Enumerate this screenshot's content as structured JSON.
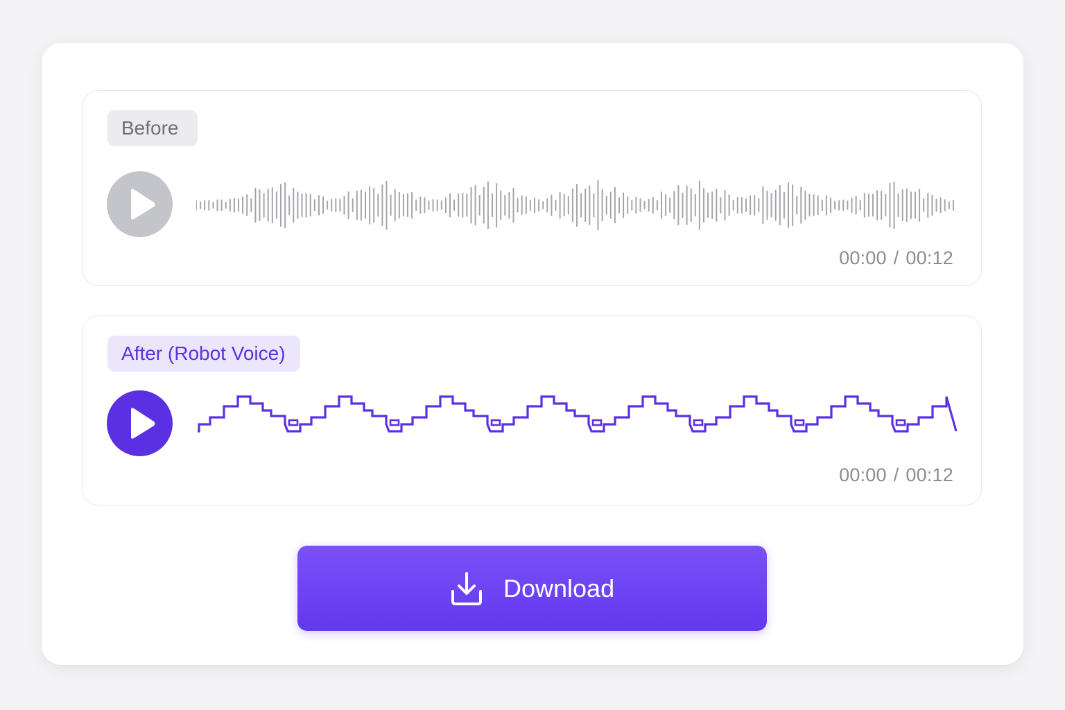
{
  "before": {
    "label": "Before",
    "time_current": "00:00",
    "time_separator": "/",
    "time_total": "00:12",
    "play_icon": "play-icon",
    "wave_color": "#a4a5ab",
    "play_color": "#c4c5cb"
  },
  "after": {
    "label": "After (Robot Voice)",
    "time_current": "00:00",
    "time_separator": "/",
    "time_total": "00:12",
    "play_icon": "play-icon",
    "wave_color": "#5b30e3",
    "play_color": "#5b30e3"
  },
  "download": {
    "label": "Download",
    "icon": "download-icon",
    "color": "#6a40f3"
  }
}
